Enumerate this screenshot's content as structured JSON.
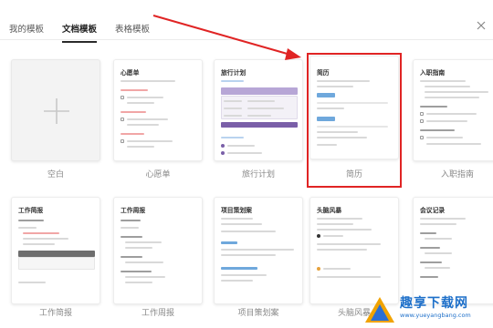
{
  "tabs": [
    {
      "label": "我的模板",
      "active": false
    },
    {
      "label": "文档模板",
      "active": true
    },
    {
      "label": "表格模板",
      "active": false
    }
  ],
  "close_icon": "close-icon",
  "row1": {
    "blank_label": "空白",
    "wish": {
      "title": "心愿单",
      "caption": "心愿单"
    },
    "travel": {
      "title": "旅行计划",
      "caption": "旅行计划"
    },
    "resume": {
      "title": "简历",
      "caption": "简历"
    },
    "onboard": {
      "title": "入职指南",
      "caption": "入职指南"
    }
  },
  "row2": {
    "weekly1": {
      "title": "工作简报",
      "caption": "工作简报"
    },
    "weekly2": {
      "title": "工作周报",
      "caption": "工作周报"
    },
    "project": {
      "title": "项目策划案",
      "caption": "项目策划案"
    },
    "storm": {
      "title": "头脑风暴",
      "caption": "头脑风暴"
    },
    "meeting": {
      "title": "会议记录",
      "caption": ""
    }
  },
  "watermark": {
    "brand": "趣享下载网",
    "url": "www.yueyangbang.com"
  },
  "colors": {
    "highlight": "#e02424",
    "accent": "#7a5fa8",
    "brand_blue": "#1d6fc9"
  }
}
